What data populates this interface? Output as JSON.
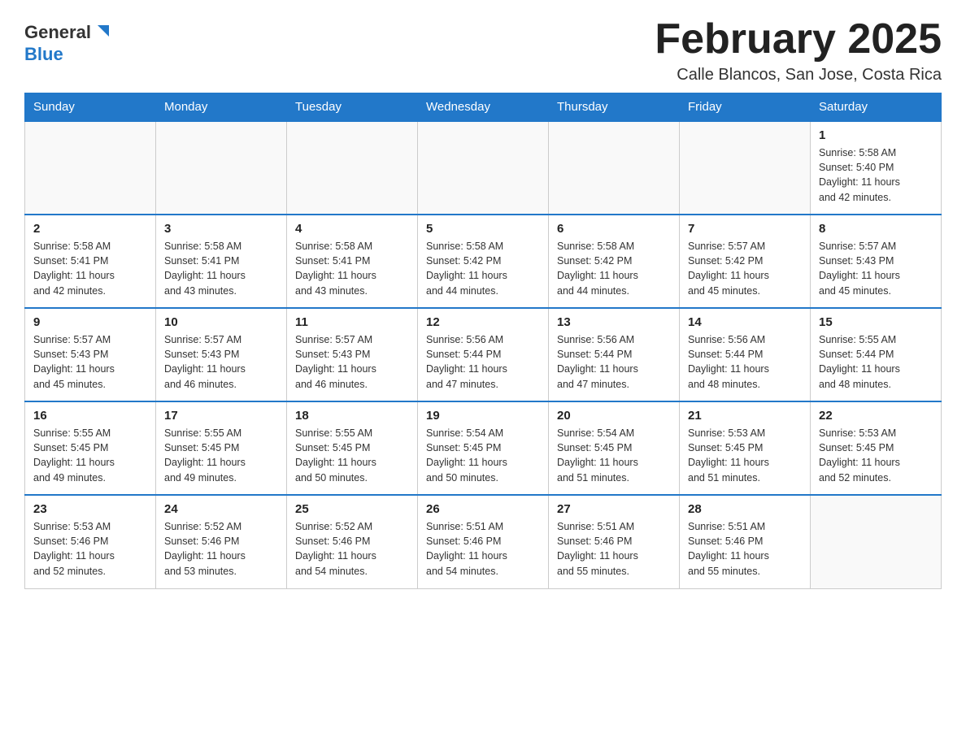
{
  "header": {
    "logo_general": "General",
    "logo_blue": "Blue",
    "month_title": "February 2025",
    "location": "Calle Blancos, San Jose, Costa Rica"
  },
  "weekdays": [
    "Sunday",
    "Monday",
    "Tuesday",
    "Wednesday",
    "Thursday",
    "Friday",
    "Saturday"
  ],
  "weeks": [
    [
      {
        "day": "",
        "info": ""
      },
      {
        "day": "",
        "info": ""
      },
      {
        "day": "",
        "info": ""
      },
      {
        "day": "",
        "info": ""
      },
      {
        "day": "",
        "info": ""
      },
      {
        "day": "",
        "info": ""
      },
      {
        "day": "1",
        "info": "Sunrise: 5:58 AM\nSunset: 5:40 PM\nDaylight: 11 hours\nand 42 minutes."
      }
    ],
    [
      {
        "day": "2",
        "info": "Sunrise: 5:58 AM\nSunset: 5:41 PM\nDaylight: 11 hours\nand 42 minutes."
      },
      {
        "day": "3",
        "info": "Sunrise: 5:58 AM\nSunset: 5:41 PM\nDaylight: 11 hours\nand 43 minutes."
      },
      {
        "day": "4",
        "info": "Sunrise: 5:58 AM\nSunset: 5:41 PM\nDaylight: 11 hours\nand 43 minutes."
      },
      {
        "day": "5",
        "info": "Sunrise: 5:58 AM\nSunset: 5:42 PM\nDaylight: 11 hours\nand 44 minutes."
      },
      {
        "day": "6",
        "info": "Sunrise: 5:58 AM\nSunset: 5:42 PM\nDaylight: 11 hours\nand 44 minutes."
      },
      {
        "day": "7",
        "info": "Sunrise: 5:57 AM\nSunset: 5:42 PM\nDaylight: 11 hours\nand 45 minutes."
      },
      {
        "day": "8",
        "info": "Sunrise: 5:57 AM\nSunset: 5:43 PM\nDaylight: 11 hours\nand 45 minutes."
      }
    ],
    [
      {
        "day": "9",
        "info": "Sunrise: 5:57 AM\nSunset: 5:43 PM\nDaylight: 11 hours\nand 45 minutes."
      },
      {
        "day": "10",
        "info": "Sunrise: 5:57 AM\nSunset: 5:43 PM\nDaylight: 11 hours\nand 46 minutes."
      },
      {
        "day": "11",
        "info": "Sunrise: 5:57 AM\nSunset: 5:43 PM\nDaylight: 11 hours\nand 46 minutes."
      },
      {
        "day": "12",
        "info": "Sunrise: 5:56 AM\nSunset: 5:44 PM\nDaylight: 11 hours\nand 47 minutes."
      },
      {
        "day": "13",
        "info": "Sunrise: 5:56 AM\nSunset: 5:44 PM\nDaylight: 11 hours\nand 47 minutes."
      },
      {
        "day": "14",
        "info": "Sunrise: 5:56 AM\nSunset: 5:44 PM\nDaylight: 11 hours\nand 48 minutes."
      },
      {
        "day": "15",
        "info": "Sunrise: 5:55 AM\nSunset: 5:44 PM\nDaylight: 11 hours\nand 48 minutes."
      }
    ],
    [
      {
        "day": "16",
        "info": "Sunrise: 5:55 AM\nSunset: 5:45 PM\nDaylight: 11 hours\nand 49 minutes."
      },
      {
        "day": "17",
        "info": "Sunrise: 5:55 AM\nSunset: 5:45 PM\nDaylight: 11 hours\nand 49 minutes."
      },
      {
        "day": "18",
        "info": "Sunrise: 5:55 AM\nSunset: 5:45 PM\nDaylight: 11 hours\nand 50 minutes."
      },
      {
        "day": "19",
        "info": "Sunrise: 5:54 AM\nSunset: 5:45 PM\nDaylight: 11 hours\nand 50 minutes."
      },
      {
        "day": "20",
        "info": "Sunrise: 5:54 AM\nSunset: 5:45 PM\nDaylight: 11 hours\nand 51 minutes."
      },
      {
        "day": "21",
        "info": "Sunrise: 5:53 AM\nSunset: 5:45 PM\nDaylight: 11 hours\nand 51 minutes."
      },
      {
        "day": "22",
        "info": "Sunrise: 5:53 AM\nSunset: 5:45 PM\nDaylight: 11 hours\nand 52 minutes."
      }
    ],
    [
      {
        "day": "23",
        "info": "Sunrise: 5:53 AM\nSunset: 5:46 PM\nDaylight: 11 hours\nand 52 minutes."
      },
      {
        "day": "24",
        "info": "Sunrise: 5:52 AM\nSunset: 5:46 PM\nDaylight: 11 hours\nand 53 minutes."
      },
      {
        "day": "25",
        "info": "Sunrise: 5:52 AM\nSunset: 5:46 PM\nDaylight: 11 hours\nand 54 minutes."
      },
      {
        "day": "26",
        "info": "Sunrise: 5:51 AM\nSunset: 5:46 PM\nDaylight: 11 hours\nand 54 minutes."
      },
      {
        "day": "27",
        "info": "Sunrise: 5:51 AM\nSunset: 5:46 PM\nDaylight: 11 hours\nand 55 minutes."
      },
      {
        "day": "28",
        "info": "Sunrise: 5:51 AM\nSunset: 5:46 PM\nDaylight: 11 hours\nand 55 minutes."
      },
      {
        "day": "",
        "info": ""
      }
    ]
  ]
}
